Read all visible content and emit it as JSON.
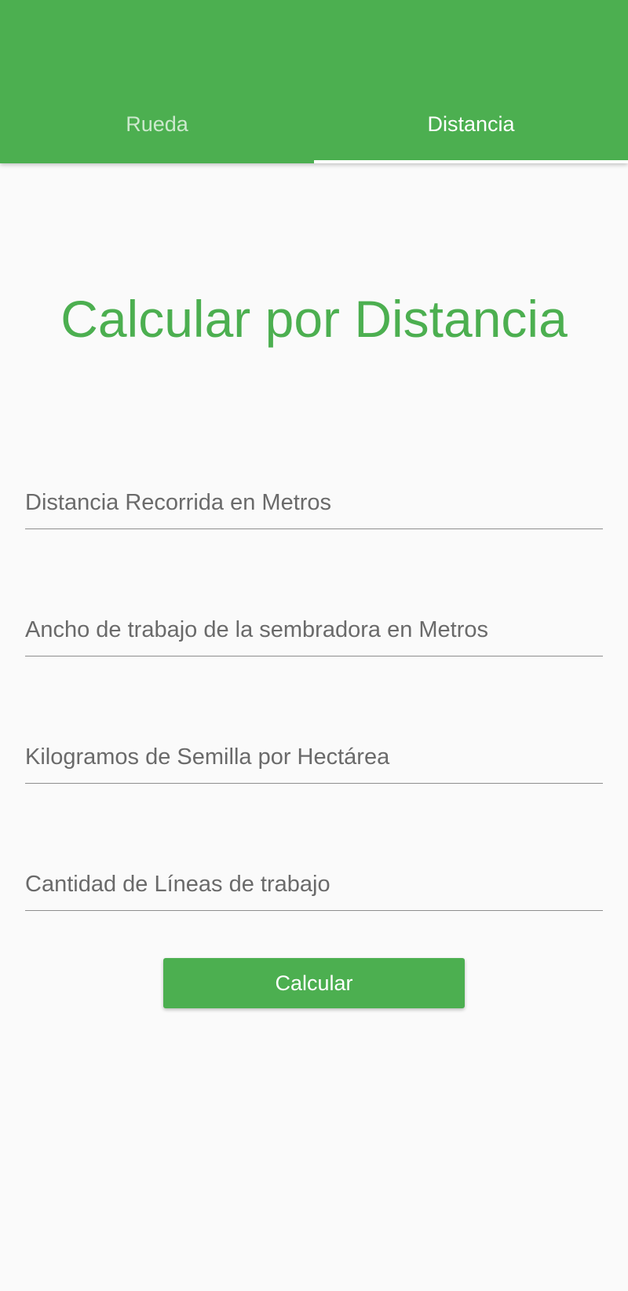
{
  "header": {
    "tabs": [
      {
        "label": "Rueda",
        "active": false
      },
      {
        "label": "Distancia",
        "active": true
      }
    ]
  },
  "main": {
    "title": "Calcular por Distancia",
    "fields": [
      {
        "placeholder": "Distancia Recorrida en Metros",
        "value": ""
      },
      {
        "placeholder": "Ancho de trabajo de la sembradora en Metros",
        "value": ""
      },
      {
        "placeholder": "Kilogramos de Semilla por Hectárea",
        "value": ""
      },
      {
        "placeholder": "Cantidad de Líneas de trabajo",
        "value": ""
      }
    ],
    "calculate_label": "Calcular"
  },
  "colors": {
    "primary": "#4caf50",
    "background": "#fafafa"
  }
}
